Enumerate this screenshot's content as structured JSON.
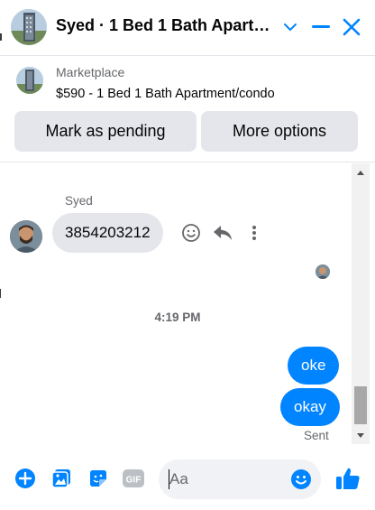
{
  "header": {
    "title": "Syed · 1 Bed 1 Bath Apartment/condo",
    "avatar_icon": "apartment-building-avatar",
    "chevron_icon": "chevron-down-icon",
    "minimize_icon": "minimize-icon",
    "close_icon": "close-icon"
  },
  "listing": {
    "source": "Marketplace",
    "title": "$590 - 1 Bed 1 Bath Apartment/condo",
    "mark_pending_label": "Mark as pending",
    "more_options_label": "More options"
  },
  "thread": {
    "sender_name": "Syed",
    "incoming_message": "3854203212",
    "timestamp": "4:19 PM",
    "outgoing_messages": [
      "oke",
      "okay"
    ],
    "status": "Sent"
  },
  "composer": {
    "placeholder": "Aa",
    "value": "",
    "icons": [
      "plus-circle-icon",
      "photo-icon",
      "sticker-icon",
      "gif-icon",
      "emoji-icon",
      "like-thumb-icon"
    ]
  },
  "colors": {
    "accent": "#0084ff",
    "incoming_bubble": "#e4e6eb",
    "secondary_text": "#65676b"
  }
}
